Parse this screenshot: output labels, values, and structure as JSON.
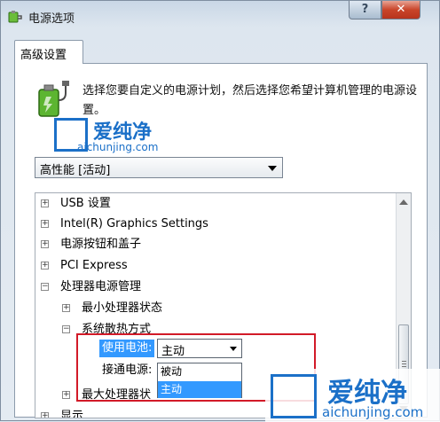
{
  "window": {
    "title": "电源选项",
    "help_label": "?",
    "close_label": "✕"
  },
  "tabs": [
    {
      "label": "高级设置"
    }
  ],
  "description": "选择您要自定义的电源计划，然后选择您希望计算机管理的电源设置。",
  "plan_select": {
    "value": "高性能 [活动]"
  },
  "tree": {
    "items": [
      {
        "expander": "+",
        "label": "USB 设置"
      },
      {
        "expander": "+",
        "label": "Intel(R) Graphics Settings"
      },
      {
        "expander": "+",
        "label": "电源按钮和盖子"
      },
      {
        "expander": "+",
        "label": "PCI Express"
      },
      {
        "expander": "−",
        "label": "处理器电源管理"
      },
      {
        "expander": "+",
        "label": "最小处理器状态"
      },
      {
        "expander": "−",
        "label": "系统散热方式"
      },
      {
        "expander": "+",
        "label": "最大处理器状"
      },
      {
        "expander": "+",
        "label": "显示"
      }
    ],
    "battery_label": "使用电池:",
    "ac_label": "接通电源:",
    "battery_value": "主动",
    "dropdown_options": [
      "被动",
      "主动"
    ],
    "selected_option": "主动"
  },
  "watermarks": {
    "top": {
      "name": "爱纯净",
      "url": "aichunjing.com"
    },
    "bottom": {
      "name": "爱纯净",
      "url": "aichunjing.com"
    }
  },
  "colors": {
    "accent": "#3399ff",
    "highlight_border": "#d21a28",
    "watermark": "#1b70c8"
  },
  "icons": [
    "power-options-icon",
    "battery-plug-icon",
    "dropdown-arrow-icon",
    "scroll-up-icon",
    "scroll-down-icon"
  ]
}
